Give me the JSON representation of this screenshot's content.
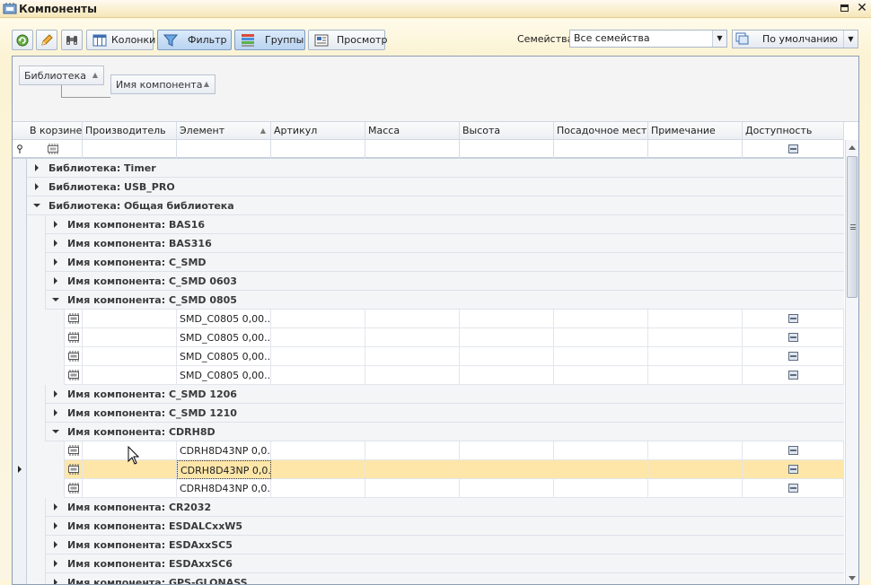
{
  "window": {
    "title": "Компоненты"
  },
  "toolbar": {
    "refresh_icon": "refresh-icon",
    "edit_icon": "pencil-icon",
    "find_icon": "binoculars-icon",
    "columns_label": "Колонки",
    "filter_label": "Фильтр",
    "groups_label": "Группы",
    "preview_label": "Просмотр",
    "families_label": "Семейства",
    "families_value": "Все семейства",
    "preset_value": "По умолчанию"
  },
  "group_panel": {
    "chips": [
      "Библиотека",
      "Имя компонента"
    ]
  },
  "columns": [
    {
      "label": "В корзине"
    },
    {
      "label": "Производитель"
    },
    {
      "label": "Элемент"
    },
    {
      "label": "Артикул"
    },
    {
      "label": "Масса"
    },
    {
      "label": "Высота"
    },
    {
      "label": "Посадочное место"
    },
    {
      "label": "Примечание"
    },
    {
      "label": "Доступность"
    }
  ],
  "rows": [
    {
      "type": "group",
      "level": 1,
      "expanded": false,
      "text": "Библиотека: Timer"
    },
    {
      "type": "group",
      "level": 1,
      "expanded": false,
      "text": "Библиотека: USB_PRO"
    },
    {
      "type": "group",
      "level": 1,
      "expanded": true,
      "text": "Библиотека: Общая библиотека"
    },
    {
      "type": "group",
      "level": 2,
      "expanded": false,
      "text": "Имя компонента: BAS16"
    },
    {
      "type": "group",
      "level": 2,
      "expanded": false,
      "text": "Имя компонента: BAS316"
    },
    {
      "type": "group",
      "level": 2,
      "expanded": false,
      "text": "Имя компонента: C_SMD"
    },
    {
      "type": "group",
      "level": 2,
      "expanded": false,
      "text": "Имя компонента: C_SMD 0603"
    },
    {
      "type": "group",
      "level": 2,
      "expanded": true,
      "text": "Имя компонента: C_SMD 0805"
    },
    {
      "type": "data",
      "element": "SMD_C0805 0,00...",
      "selected": false
    },
    {
      "type": "data",
      "element": "SMD_C0805 0,00...",
      "selected": false
    },
    {
      "type": "data",
      "element": "SMD_C0805 0,00...",
      "selected": false
    },
    {
      "type": "data",
      "element": "SMD_C0805 0,00...",
      "selected": false
    },
    {
      "type": "group",
      "level": 2,
      "expanded": false,
      "text": "Имя компонента: C_SMD 1206"
    },
    {
      "type": "group",
      "level": 2,
      "expanded": false,
      "text": "Имя компонента: C_SMD 1210"
    },
    {
      "type": "group",
      "level": 2,
      "expanded": true,
      "text": "Имя компонента: CDRH8D"
    },
    {
      "type": "data",
      "element": "CDRH8D43NP 0,0...",
      "selected": false
    },
    {
      "type": "data",
      "element": "CDRH8D43NP 0,0...",
      "selected": true
    },
    {
      "type": "data",
      "element": "CDRH8D43NP 0,0...",
      "selected": false
    },
    {
      "type": "group",
      "level": 2,
      "expanded": false,
      "text": "Имя компонента: CR2032"
    },
    {
      "type": "group",
      "level": 2,
      "expanded": false,
      "text": "Имя компонента: ESDALCxxW5"
    },
    {
      "type": "group",
      "level": 2,
      "expanded": false,
      "text": "Имя компонента: ESDAxxSC5"
    },
    {
      "type": "group",
      "level": 2,
      "expanded": false,
      "text": "Имя компонента: ESDAxxSC6"
    },
    {
      "type": "group",
      "level": 2,
      "expanded": false,
      "text": "Имя компонента: GPS-GLONASS"
    }
  ]
}
